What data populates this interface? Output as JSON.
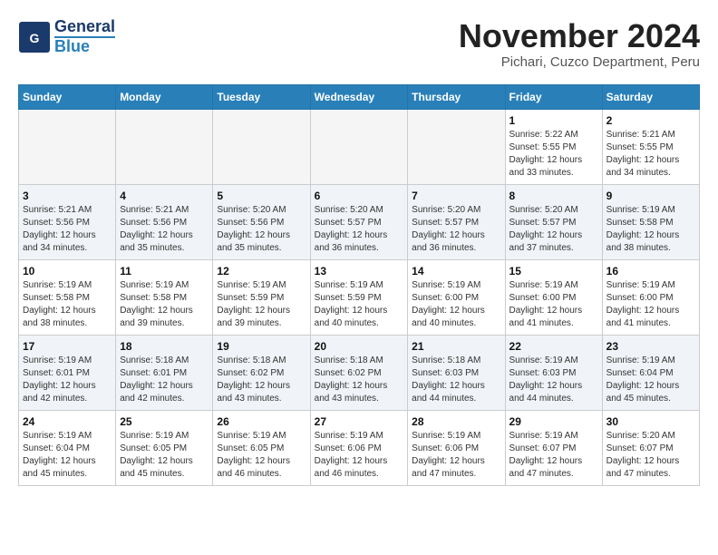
{
  "header": {
    "logo_general": "General",
    "logo_blue": "Blue",
    "month_title": "November 2024",
    "location": "Pichari, Cuzco Department, Peru"
  },
  "weekdays": [
    "Sunday",
    "Monday",
    "Tuesday",
    "Wednesday",
    "Thursday",
    "Friday",
    "Saturday"
  ],
  "weeks": [
    [
      {
        "day": "",
        "info": ""
      },
      {
        "day": "",
        "info": ""
      },
      {
        "day": "",
        "info": ""
      },
      {
        "day": "",
        "info": ""
      },
      {
        "day": "",
        "info": ""
      },
      {
        "day": "1",
        "info": "Sunrise: 5:22 AM\nSunset: 5:55 PM\nDaylight: 12 hours\nand 33 minutes."
      },
      {
        "day": "2",
        "info": "Sunrise: 5:21 AM\nSunset: 5:55 PM\nDaylight: 12 hours\nand 34 minutes."
      }
    ],
    [
      {
        "day": "3",
        "info": "Sunrise: 5:21 AM\nSunset: 5:56 PM\nDaylight: 12 hours\nand 34 minutes."
      },
      {
        "day": "4",
        "info": "Sunrise: 5:21 AM\nSunset: 5:56 PM\nDaylight: 12 hours\nand 35 minutes."
      },
      {
        "day": "5",
        "info": "Sunrise: 5:20 AM\nSunset: 5:56 PM\nDaylight: 12 hours\nand 35 minutes."
      },
      {
        "day": "6",
        "info": "Sunrise: 5:20 AM\nSunset: 5:57 PM\nDaylight: 12 hours\nand 36 minutes."
      },
      {
        "day": "7",
        "info": "Sunrise: 5:20 AM\nSunset: 5:57 PM\nDaylight: 12 hours\nand 36 minutes."
      },
      {
        "day": "8",
        "info": "Sunrise: 5:20 AM\nSunset: 5:57 PM\nDaylight: 12 hours\nand 37 minutes."
      },
      {
        "day": "9",
        "info": "Sunrise: 5:19 AM\nSunset: 5:58 PM\nDaylight: 12 hours\nand 38 minutes."
      }
    ],
    [
      {
        "day": "10",
        "info": "Sunrise: 5:19 AM\nSunset: 5:58 PM\nDaylight: 12 hours\nand 38 minutes."
      },
      {
        "day": "11",
        "info": "Sunrise: 5:19 AM\nSunset: 5:58 PM\nDaylight: 12 hours\nand 39 minutes."
      },
      {
        "day": "12",
        "info": "Sunrise: 5:19 AM\nSunset: 5:59 PM\nDaylight: 12 hours\nand 39 minutes."
      },
      {
        "day": "13",
        "info": "Sunrise: 5:19 AM\nSunset: 5:59 PM\nDaylight: 12 hours\nand 40 minutes."
      },
      {
        "day": "14",
        "info": "Sunrise: 5:19 AM\nSunset: 6:00 PM\nDaylight: 12 hours\nand 40 minutes."
      },
      {
        "day": "15",
        "info": "Sunrise: 5:19 AM\nSunset: 6:00 PM\nDaylight: 12 hours\nand 41 minutes."
      },
      {
        "day": "16",
        "info": "Sunrise: 5:19 AM\nSunset: 6:00 PM\nDaylight: 12 hours\nand 41 minutes."
      }
    ],
    [
      {
        "day": "17",
        "info": "Sunrise: 5:19 AM\nSunset: 6:01 PM\nDaylight: 12 hours\nand 42 minutes."
      },
      {
        "day": "18",
        "info": "Sunrise: 5:18 AM\nSunset: 6:01 PM\nDaylight: 12 hours\nand 42 minutes."
      },
      {
        "day": "19",
        "info": "Sunrise: 5:18 AM\nSunset: 6:02 PM\nDaylight: 12 hours\nand 43 minutes."
      },
      {
        "day": "20",
        "info": "Sunrise: 5:18 AM\nSunset: 6:02 PM\nDaylight: 12 hours\nand 43 minutes."
      },
      {
        "day": "21",
        "info": "Sunrise: 5:18 AM\nSunset: 6:03 PM\nDaylight: 12 hours\nand 44 minutes."
      },
      {
        "day": "22",
        "info": "Sunrise: 5:19 AM\nSunset: 6:03 PM\nDaylight: 12 hours\nand 44 minutes."
      },
      {
        "day": "23",
        "info": "Sunrise: 5:19 AM\nSunset: 6:04 PM\nDaylight: 12 hours\nand 45 minutes."
      }
    ],
    [
      {
        "day": "24",
        "info": "Sunrise: 5:19 AM\nSunset: 6:04 PM\nDaylight: 12 hours\nand 45 minutes."
      },
      {
        "day": "25",
        "info": "Sunrise: 5:19 AM\nSunset: 6:05 PM\nDaylight: 12 hours\nand 45 minutes."
      },
      {
        "day": "26",
        "info": "Sunrise: 5:19 AM\nSunset: 6:05 PM\nDaylight: 12 hours\nand 46 minutes."
      },
      {
        "day": "27",
        "info": "Sunrise: 5:19 AM\nSunset: 6:06 PM\nDaylight: 12 hours\nand 46 minutes."
      },
      {
        "day": "28",
        "info": "Sunrise: 5:19 AM\nSunset: 6:06 PM\nDaylight: 12 hours\nand 47 minutes."
      },
      {
        "day": "29",
        "info": "Sunrise: 5:19 AM\nSunset: 6:07 PM\nDaylight: 12 hours\nand 47 minutes."
      },
      {
        "day": "30",
        "info": "Sunrise: 5:20 AM\nSunset: 6:07 PM\nDaylight: 12 hours\nand 47 minutes."
      }
    ]
  ]
}
